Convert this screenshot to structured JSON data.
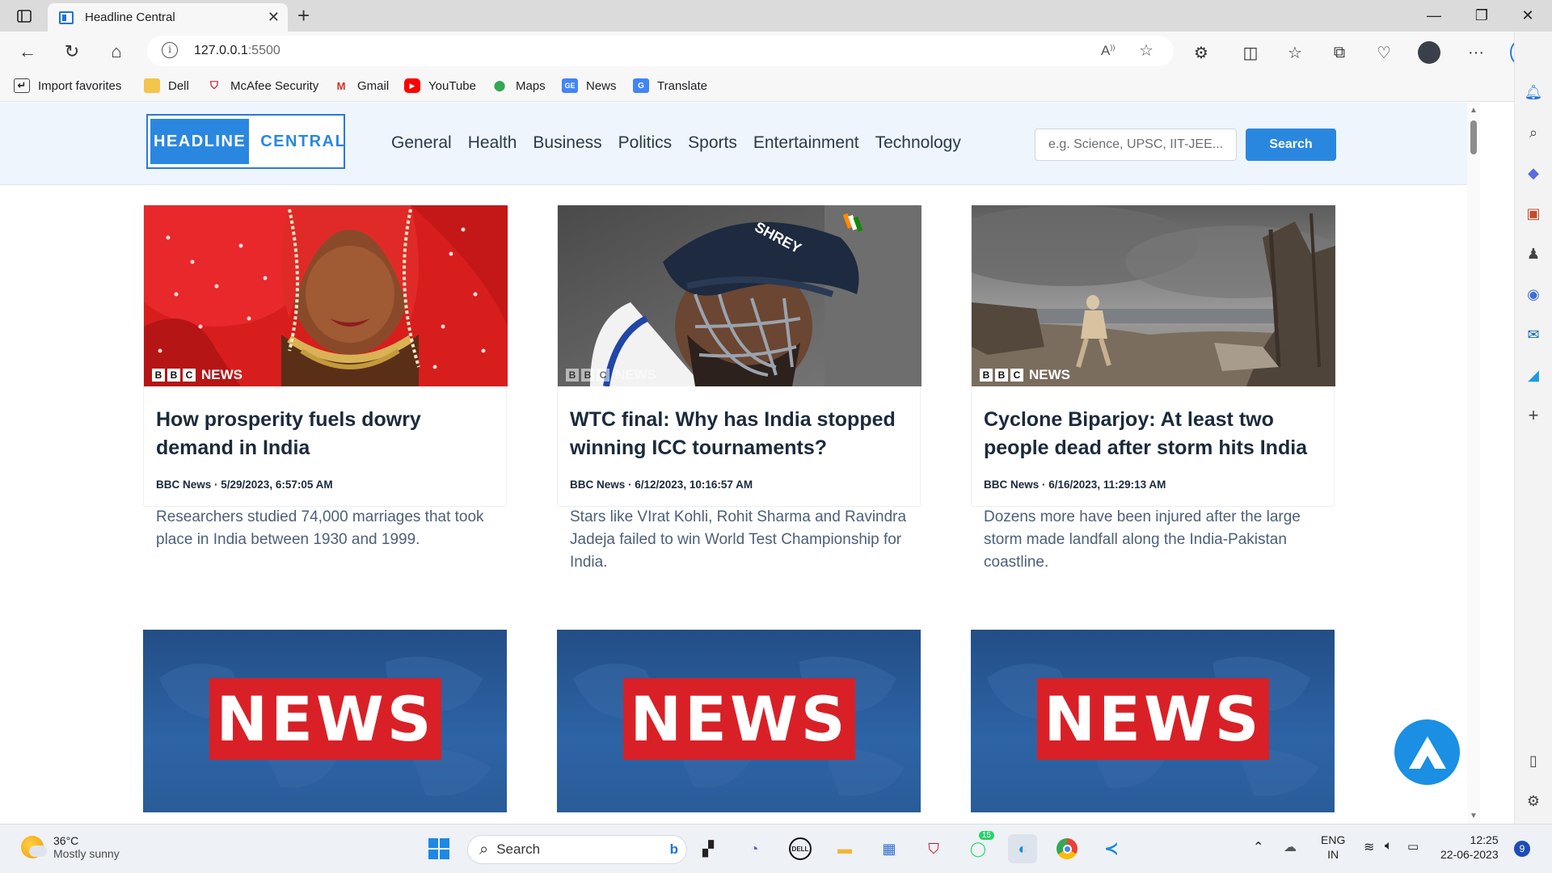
{
  "browser": {
    "tab_title": "Headline Central",
    "url_host": "127.0.0.1",
    "url_port": ":5500"
  },
  "bookmarks": [
    {
      "label": "Import favorites",
      "icon": "import-icon"
    },
    {
      "label": "Dell",
      "icon": "folder-icon"
    },
    {
      "label": "McAfee Security",
      "icon": "mcafee-icon"
    },
    {
      "label": "Gmail",
      "icon": "gmail-icon"
    },
    {
      "label": "YouTube",
      "icon": "youtube-icon"
    },
    {
      "label": "Maps",
      "icon": "maps-icon"
    },
    {
      "label": "News",
      "icon": "news-icon"
    },
    {
      "label": "Translate",
      "icon": "translate-icon"
    }
  ],
  "site": {
    "logo_part1": "HEADLINE",
    "logo_part2": "CENTRAL",
    "nav": [
      "General",
      "Health",
      "Business",
      "Politics",
      "Sports",
      "Entertainment",
      "Technology"
    ],
    "search_placeholder": "e.g. Science, UPSC, IIT-JEE...",
    "search_button": "Search",
    "accent_color": "#2a87e0"
  },
  "articles": [
    {
      "title": "How prosperity fuels dowry demand in India",
      "meta": "BBC News · 5/29/2023, 6:57:05 AM",
      "description": "Researchers studied 74,000 marriages that took place in India between 1930 and 1999.",
      "image_brand": "NEWS"
    },
    {
      "title": "WTC final: Why has India stopped winning ICC tournaments?",
      "meta": "BBC News · 6/12/2023, 10:16:57 AM",
      "description": "Stars like VIrat Kohli, Rohit Sharma and Ravindra Jadeja failed to win World Test Championship for India.",
      "image_brand": "NEWS",
      "helmet_text": "SHREY"
    },
    {
      "title": "Cyclone Biparjoy: At least two people dead after storm hits India",
      "meta": "BBC News · 6/16/2023, 11:29:13 AM",
      "description": "Dozens more have been injured after the large storm made landfall along the India-Pakistan coastline.",
      "image_brand": "NEWS"
    }
  ],
  "placeholder_cards": [
    "NEWS",
    "NEWS",
    "NEWS"
  ],
  "taskbar": {
    "temp": "36°C",
    "weather": "Mostly sunny",
    "search": "Search",
    "whatsapp_badge": "15",
    "lang1": "ENG",
    "lang2": "IN",
    "time": "12:25",
    "date": "22-06-2023",
    "notif_count": "9"
  }
}
